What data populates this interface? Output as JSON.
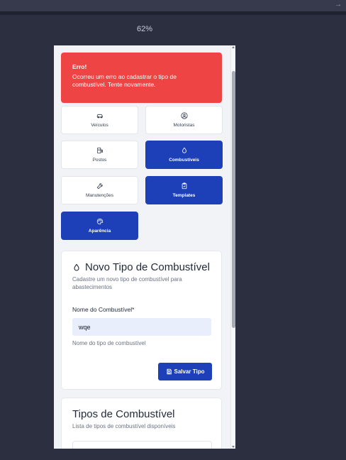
{
  "browser": {
    "zoom": "62%",
    "forward_icon": "arrow-right-icon"
  },
  "alert": {
    "title": "Erro!",
    "message": "Ocorreu um erro ao cadastrar o tipo de combustível. Tente novamente.",
    "color": "#ef4444"
  },
  "nav": {
    "items": [
      {
        "label": "Veículos",
        "icon": "car-icon",
        "active": false
      },
      {
        "label": "Motoristas",
        "icon": "user-circle-icon",
        "active": false
      },
      {
        "label": "Postos",
        "icon": "fuel-icon",
        "active": false
      },
      {
        "label": "Combustíveis",
        "icon": "droplet-icon",
        "active": true
      },
      {
        "label": "Manutenções",
        "icon": "wrench-icon",
        "active": false
      },
      {
        "label": "Templates",
        "icon": "clipboard-icon",
        "active": true
      },
      {
        "label": "Aparência",
        "icon": "palette-icon",
        "active": true
      }
    ],
    "active_color": "#1d40b8"
  },
  "form": {
    "title": "Novo Tipo de Combustível",
    "subtitle": "Cadastre um novo tipo de combustível para abastecimentos",
    "field_label": "Nome do Combustível*",
    "field_value": "wqe",
    "field_hint": "Nome do tipo de combustível",
    "save_label": "Salvar Tipo"
  },
  "list": {
    "title": "Tipos de Combustível",
    "subtitle": "Lista de tipos de combustível disponíveis"
  }
}
